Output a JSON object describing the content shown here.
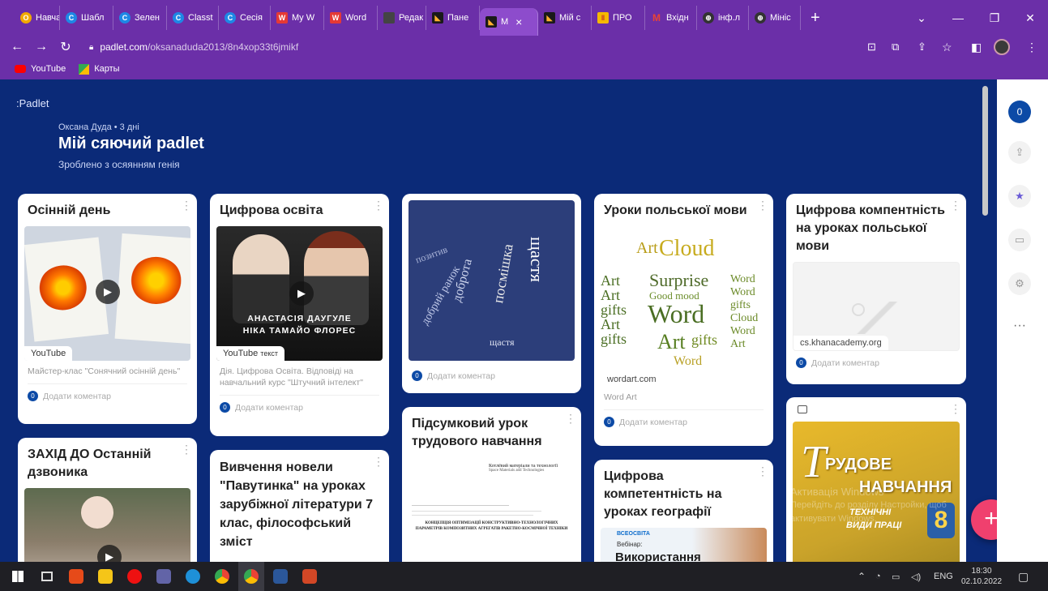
{
  "browser": {
    "tabs": [
      {
        "label": "Навча",
        "color": "#f2a900"
      },
      {
        "label": "Шабл",
        "color": "#1e88e5"
      },
      {
        "label": "Зелен",
        "color": "#1e88e5"
      },
      {
        "label": "Classt",
        "color": "#1e88e5"
      },
      {
        "label": "Сесія",
        "color": "#1e88e5"
      },
      {
        "label": "My W",
        "color": "#e53935"
      },
      {
        "label": "Word",
        "color": "#e53935"
      },
      {
        "label": "Редак",
        "color": "#444444"
      },
      {
        "label": "Пане",
        "color": "#1a1a1a"
      },
      {
        "label": "М",
        "color": "#1a1a1a"
      },
      {
        "label": "Мій с",
        "color": "#1a1a1a"
      },
      {
        "label": "ПРО",
        "color": "#f5b800"
      },
      {
        "label": "Вхідн",
        "color": "#ea4335"
      },
      {
        "label": "інф.л",
        "color": "#333333"
      },
      {
        "label": "Мініс",
        "color": "#333333"
      }
    ],
    "active_tab_close": "×",
    "new_tab": "+",
    "url_host": "padlet.com",
    "url_path": "/oksanaduda2013/8n4xop33t6jmikf",
    "bookmarks": [
      "YouTube",
      "Карты"
    ]
  },
  "padlet": {
    "logo": ":Padlet",
    "author_line": "Оксана Дуда • 3 дні",
    "title": "Мій сяючий padlet",
    "subtitle": "Зроблено з осяянням генія",
    "add_comment": "Додати коментар",
    "comment_count": "0"
  },
  "cards": {
    "c1": {
      "title": "Осінній день",
      "tag": "YouTube",
      "desc": "Майстер-клас \"Сонячний осінній день\""
    },
    "c2": {
      "title": "Цифрова освіта",
      "tag": "YouTube",
      "tag2": "текст",
      "overlay1": "АНАСТАСІЯ ДАУГУЛЕ",
      "overlay2": "НІКА ТАМАЙО ФЛОРЕС",
      "desc": "Дія. Цифрова Освіта. Відповіді на навчальний курс \"Штучний інтелект\""
    },
    "c3": {
      "cloud_words": [
        "щастя",
        "посмішка",
        "доброта",
        "добрий ранок",
        "позитив",
        "щастя"
      ]
    },
    "c4": {
      "title": "Уроки польської мови",
      "cloud_words": [
        "Cloud",
        "Art",
        "Surprise",
        "Word",
        "Good mood",
        "gifts",
        "Art",
        "Word"
      ],
      "link": "wordart.com",
      "desc": "Word Art"
    },
    "c5": {
      "title": "Цифрова компентність на уроках польської мови",
      "link": "cs.khanacademy.org"
    },
    "c6": {
      "title": "ЗАХІД ДО Останній дзвоника"
    },
    "c7": {
      "title": "Вивчення новели \"Павутинка\" на уроках зарубіжної літератури 7 клас, філософський зміст"
    },
    "c8": {
      "title": "Підсумковий урок трудового навчання",
      "doc_head": "Котлёвий матеріали та технології",
      "doc_sub": "Space Materials and Technologies",
      "doc_body": "КОНЦЕПЦІЯ ОПТИМІЗАЦІЇ КОНСТРУКТИВНО-ТЕХНОЛОГІЧНИХ ПАРАМЕТРІВ КОМПОЗИТНИХ АГРЕГАТІВ РАКЕТНО-КОСМІЧНОЇ ТЕХНІКИ"
    },
    "c9": {
      "title": "Цифрова компетентність на уроках географії",
      "badge": "ВСЕОСВІТА",
      "sub": "Вебінар:",
      "big": "Використання"
    },
    "c10": {
      "title_line1": "РУДОВЕ",
      "title_line2": "НАВЧАННЯ",
      "sub1": "ТЕХНІЧНІ",
      "sub2": "ВИДИ ПРАЦІ",
      "grade": "8"
    }
  },
  "watermark": {
    "line1": "Активація Windows",
    "line2": "Перейдіть до розділу Настройки, щоб активувати Windows."
  },
  "fab": "+",
  "taskbar": {
    "lang": "ENG",
    "time": "18:30",
    "date": "02.10.2022"
  }
}
